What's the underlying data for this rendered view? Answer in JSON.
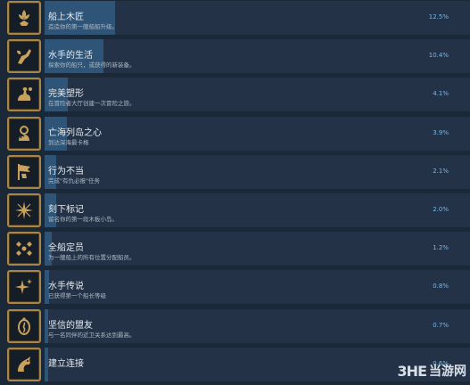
{
  "achievements": [
    {
      "title": "船上木匠",
      "desc": "造造你的第一艘船船升级。",
      "percent": "12.5%",
      "progress": 0.125,
      "icon": "hand-plant-icon"
    },
    {
      "title": "水手的生活",
      "desc": "探索你的船只，或获得的新装备。",
      "percent": "10.4%",
      "progress": 0.104,
      "icon": "fist-leaf-icon"
    },
    {
      "title": "完美塑形",
      "desc": "在冒险者大厅创建一次冒险之旅。",
      "percent": "4.1%",
      "progress": 0.041,
      "icon": "strong-arm-icon"
    },
    {
      "title": "亡海列岛之心",
      "desc": "到达深海最卡格",
      "percent": "3.9%",
      "progress": 0.039,
      "icon": "ship-wheel-icon"
    },
    {
      "title": "行为不当",
      "desc": "完成\"有仇必报\"任务",
      "percent": "2.1%",
      "progress": 0.021,
      "icon": "flag-hand-icon"
    },
    {
      "title": "刻下标记",
      "desc": "留名你的第一段木板小岛。",
      "percent": "2.0%",
      "progress": 0.02,
      "icon": "star-compass-icon"
    },
    {
      "title": "全船定员",
      "desc": "为一艘船上的所有位置分配船员。",
      "percent": "1.2%",
      "progress": 0.012,
      "icon": "crew-icon"
    },
    {
      "title": "水手传说",
      "desc": "已获得第一个船长等级",
      "percent": "0.8%",
      "progress": 0.008,
      "icon": "sparkle-icon"
    },
    {
      "title": "坚信的盟友",
      "desc": "与一名同伴的近卫关系达到最高。",
      "percent": "0.7%",
      "progress": 0.007,
      "icon": "medallion-icon"
    },
    {
      "title": "建立连接",
      "desc": "",
      "percent": "0.6%",
      "progress": 0.006,
      "icon": "dragon-icon"
    }
  ],
  "watermark": {
    "logo": "3HE",
    "text": "当游网"
  }
}
